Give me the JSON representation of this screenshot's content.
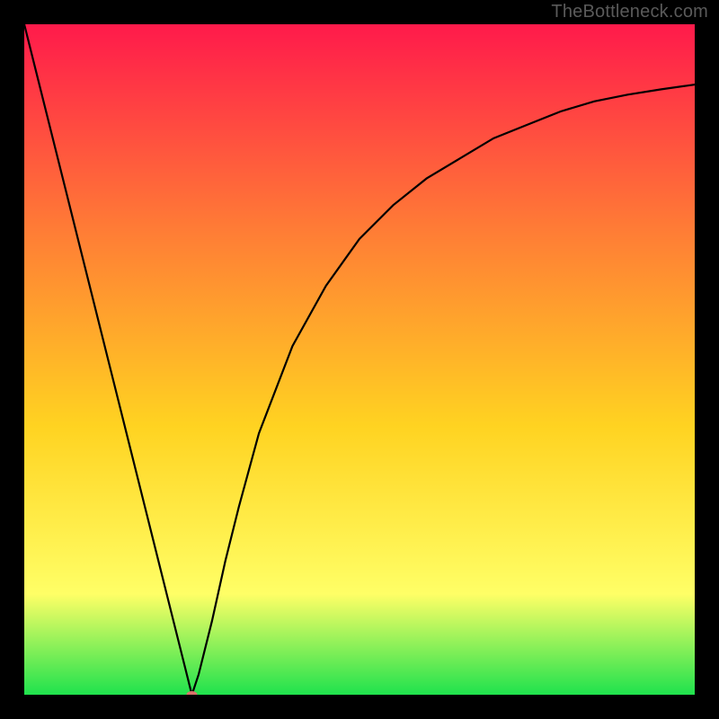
{
  "watermark": {
    "text": "TheBottleneck.com"
  },
  "chart_data": {
    "type": "line",
    "title": "",
    "xlabel": "",
    "ylabel": "",
    "xlim": [
      0,
      100
    ],
    "ylim": [
      0,
      100
    ],
    "grid": false,
    "background_gradient": {
      "top_color": "#ff1a4b",
      "mid_top_color": "#ff7a36",
      "mid_color": "#ffd321",
      "lower_color": "#ffff66",
      "bottom_color": "#1fe24d"
    },
    "series": [
      {
        "name": "curve",
        "color": "#000000",
        "x": [
          0,
          2,
          4,
          6,
          8,
          10,
          12,
          14,
          16,
          18,
          20,
          22,
          24,
          25,
          26,
          28,
          30,
          32,
          35,
          40,
          45,
          50,
          55,
          60,
          65,
          70,
          75,
          80,
          85,
          90,
          95,
          100
        ],
        "y": [
          100,
          92,
          84,
          76,
          68,
          60,
          52,
          44,
          36,
          28,
          20,
          12,
          4,
          0,
          3,
          11,
          20,
          28,
          39,
          52,
          61,
          68,
          73,
          77,
          80,
          83,
          85,
          87,
          88.5,
          89.5,
          90.3,
          91
        ]
      }
    ],
    "marker": {
      "name": "minimum-point",
      "x": 25,
      "y": 0,
      "color": "#d9736b",
      "rx": 6,
      "ry": 4
    }
  }
}
